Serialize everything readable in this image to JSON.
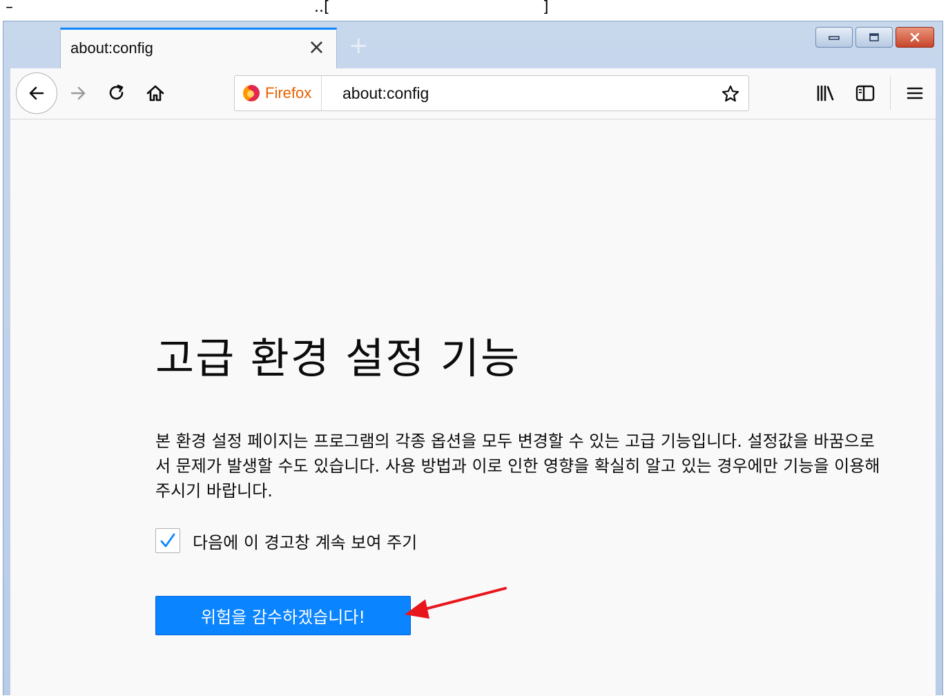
{
  "caption": {
    "left": "–",
    "mid": "..[",
    "right": "]"
  },
  "browser": {
    "tab_title": "about:config",
    "tab_close": "×",
    "new_tab": "+",
    "identity_label": "Firefox",
    "url": "about:config"
  },
  "page": {
    "title": "고급 환경 설정 기능",
    "description": "본 환경 설정 페이지는 프로그램의 각종 옵션을 모두 변경할 수 있는 고급 기능입니다. 설정값을 바꿈으로서 문제가 발생할 수도 있습니다. 사용 방법과 이로 인한 영향을 확실히 알고 있는 경우에만 기능을 이용해 주시기 바랍니다.",
    "checkbox_label": "다음에 이 경고창 계속 보여 주기",
    "checkbox_checked": true,
    "accept_button": "위험을 감수하겠습니다!"
  },
  "colors": {
    "accent": "#0a84ff",
    "annotation_arrow": "#e8151b",
    "firefox_orange": "#e66000"
  },
  "icons": [
    "back-arrow-icon",
    "forward-arrow-icon",
    "reload-icon",
    "home-icon",
    "firefox-logo-icon",
    "star-icon",
    "library-icon",
    "sidebar-icon",
    "hamburger-menu-icon",
    "checkmark-icon",
    "red-arrow-annotation"
  ]
}
